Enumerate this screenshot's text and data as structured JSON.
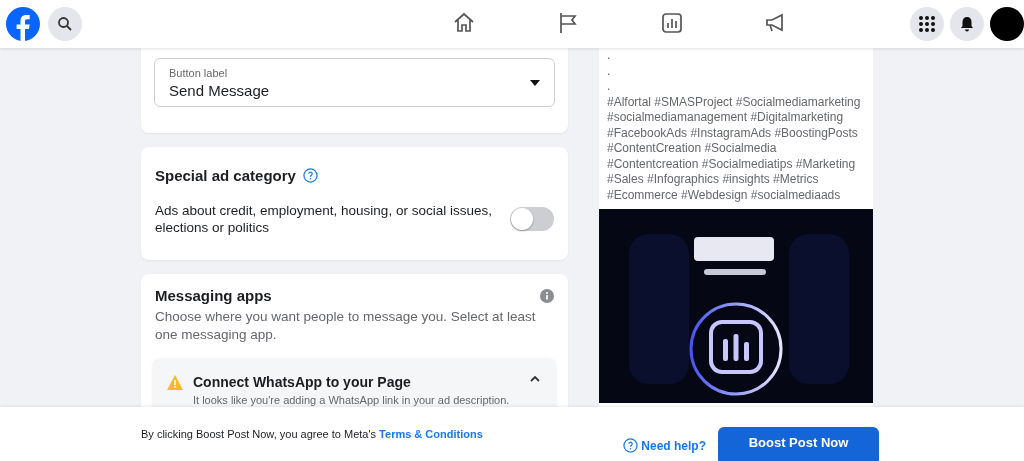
{
  "nav": {
    "tabs": [
      {
        "kind": "home",
        "selected": false
      },
      {
        "kind": "flag",
        "selected": false
      },
      {
        "kind": "chart",
        "selected": false
      },
      {
        "kind": "megaphone",
        "selected": false
      }
    ]
  },
  "button_label_field": {
    "label": "Button label",
    "value": "Send Message"
  },
  "special_ad_category": {
    "title": "Special ad category",
    "toggle_label": "Ads about credit, employment, housing, or social issues, elections or politics",
    "on": false
  },
  "messaging_apps": {
    "title": "Messaging apps",
    "description": "Choose where you want people to message you. Select at least one messaging app.",
    "notice": {
      "title": "Connect WhatsApp to your Page",
      "text": "It looks like you're adding a WhatsApp link in your ad description.",
      "expanded": true
    }
  },
  "post_preview": {
    "lines": [
      ".",
      ".",
      "."
    ],
    "hashtags": "#Alfortal #SMASProject #Socialmediamarketing #socialmediamanagement #Digitalmarketing #FacebookAds #InstagramAds #BoostingPosts #ContentCreation #Socialmedia #Contentcreation #Socialmediatips #Marketing #Sales #Infographics #insights #Metrics #Ecommerce #Webdesign #socialmediaads",
    "image": {
      "kind": "picture"
    }
  },
  "footer": {
    "agreement": "By clicking Boost Post Now, you agree to Meta's",
    "terms_link": "Terms & Conditions",
    "help_link": "Need help?",
    "primary_button": "Boost Post Now"
  }
}
